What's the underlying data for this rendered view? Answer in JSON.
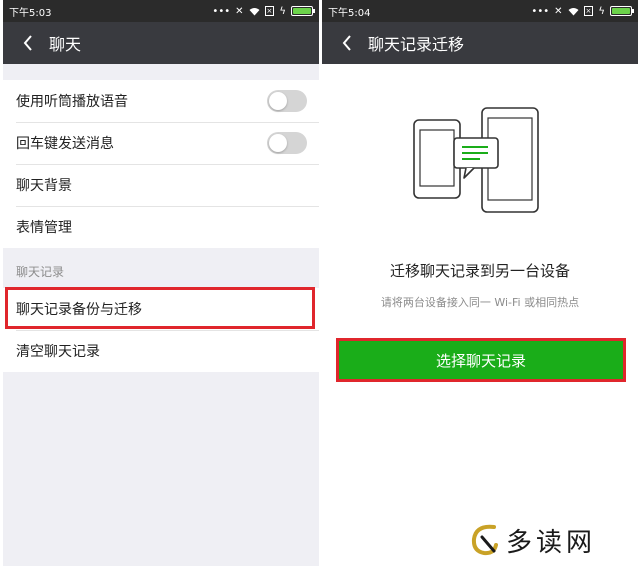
{
  "left": {
    "status": {
      "time": "下午5:03"
    },
    "title": "聊天",
    "settings": [
      {
        "label": "使用听筒播放语音",
        "toggle": false
      },
      {
        "label": "回车键发送消息",
        "toggle": false
      },
      {
        "label": "聊天背景"
      },
      {
        "label": "表情管理"
      }
    ],
    "section_label": "聊天记录",
    "records": [
      {
        "label": "聊天记录备份与迁移"
      },
      {
        "label": "清空聊天记录"
      }
    ]
  },
  "right": {
    "status": {
      "time": "下午5:04"
    },
    "title": "聊天记录迁移",
    "heading": "迁移聊天记录到另一台设备",
    "subtext": "请将两台设备接入同一 Wi-Fi 或相同热点",
    "button_label": "选择聊天记录"
  },
  "watermark": {
    "text": "多读网"
  },
  "colors": {
    "titlebar": "#393a3f",
    "accent_green": "#1aad19",
    "highlight_red": "#e0262c"
  }
}
